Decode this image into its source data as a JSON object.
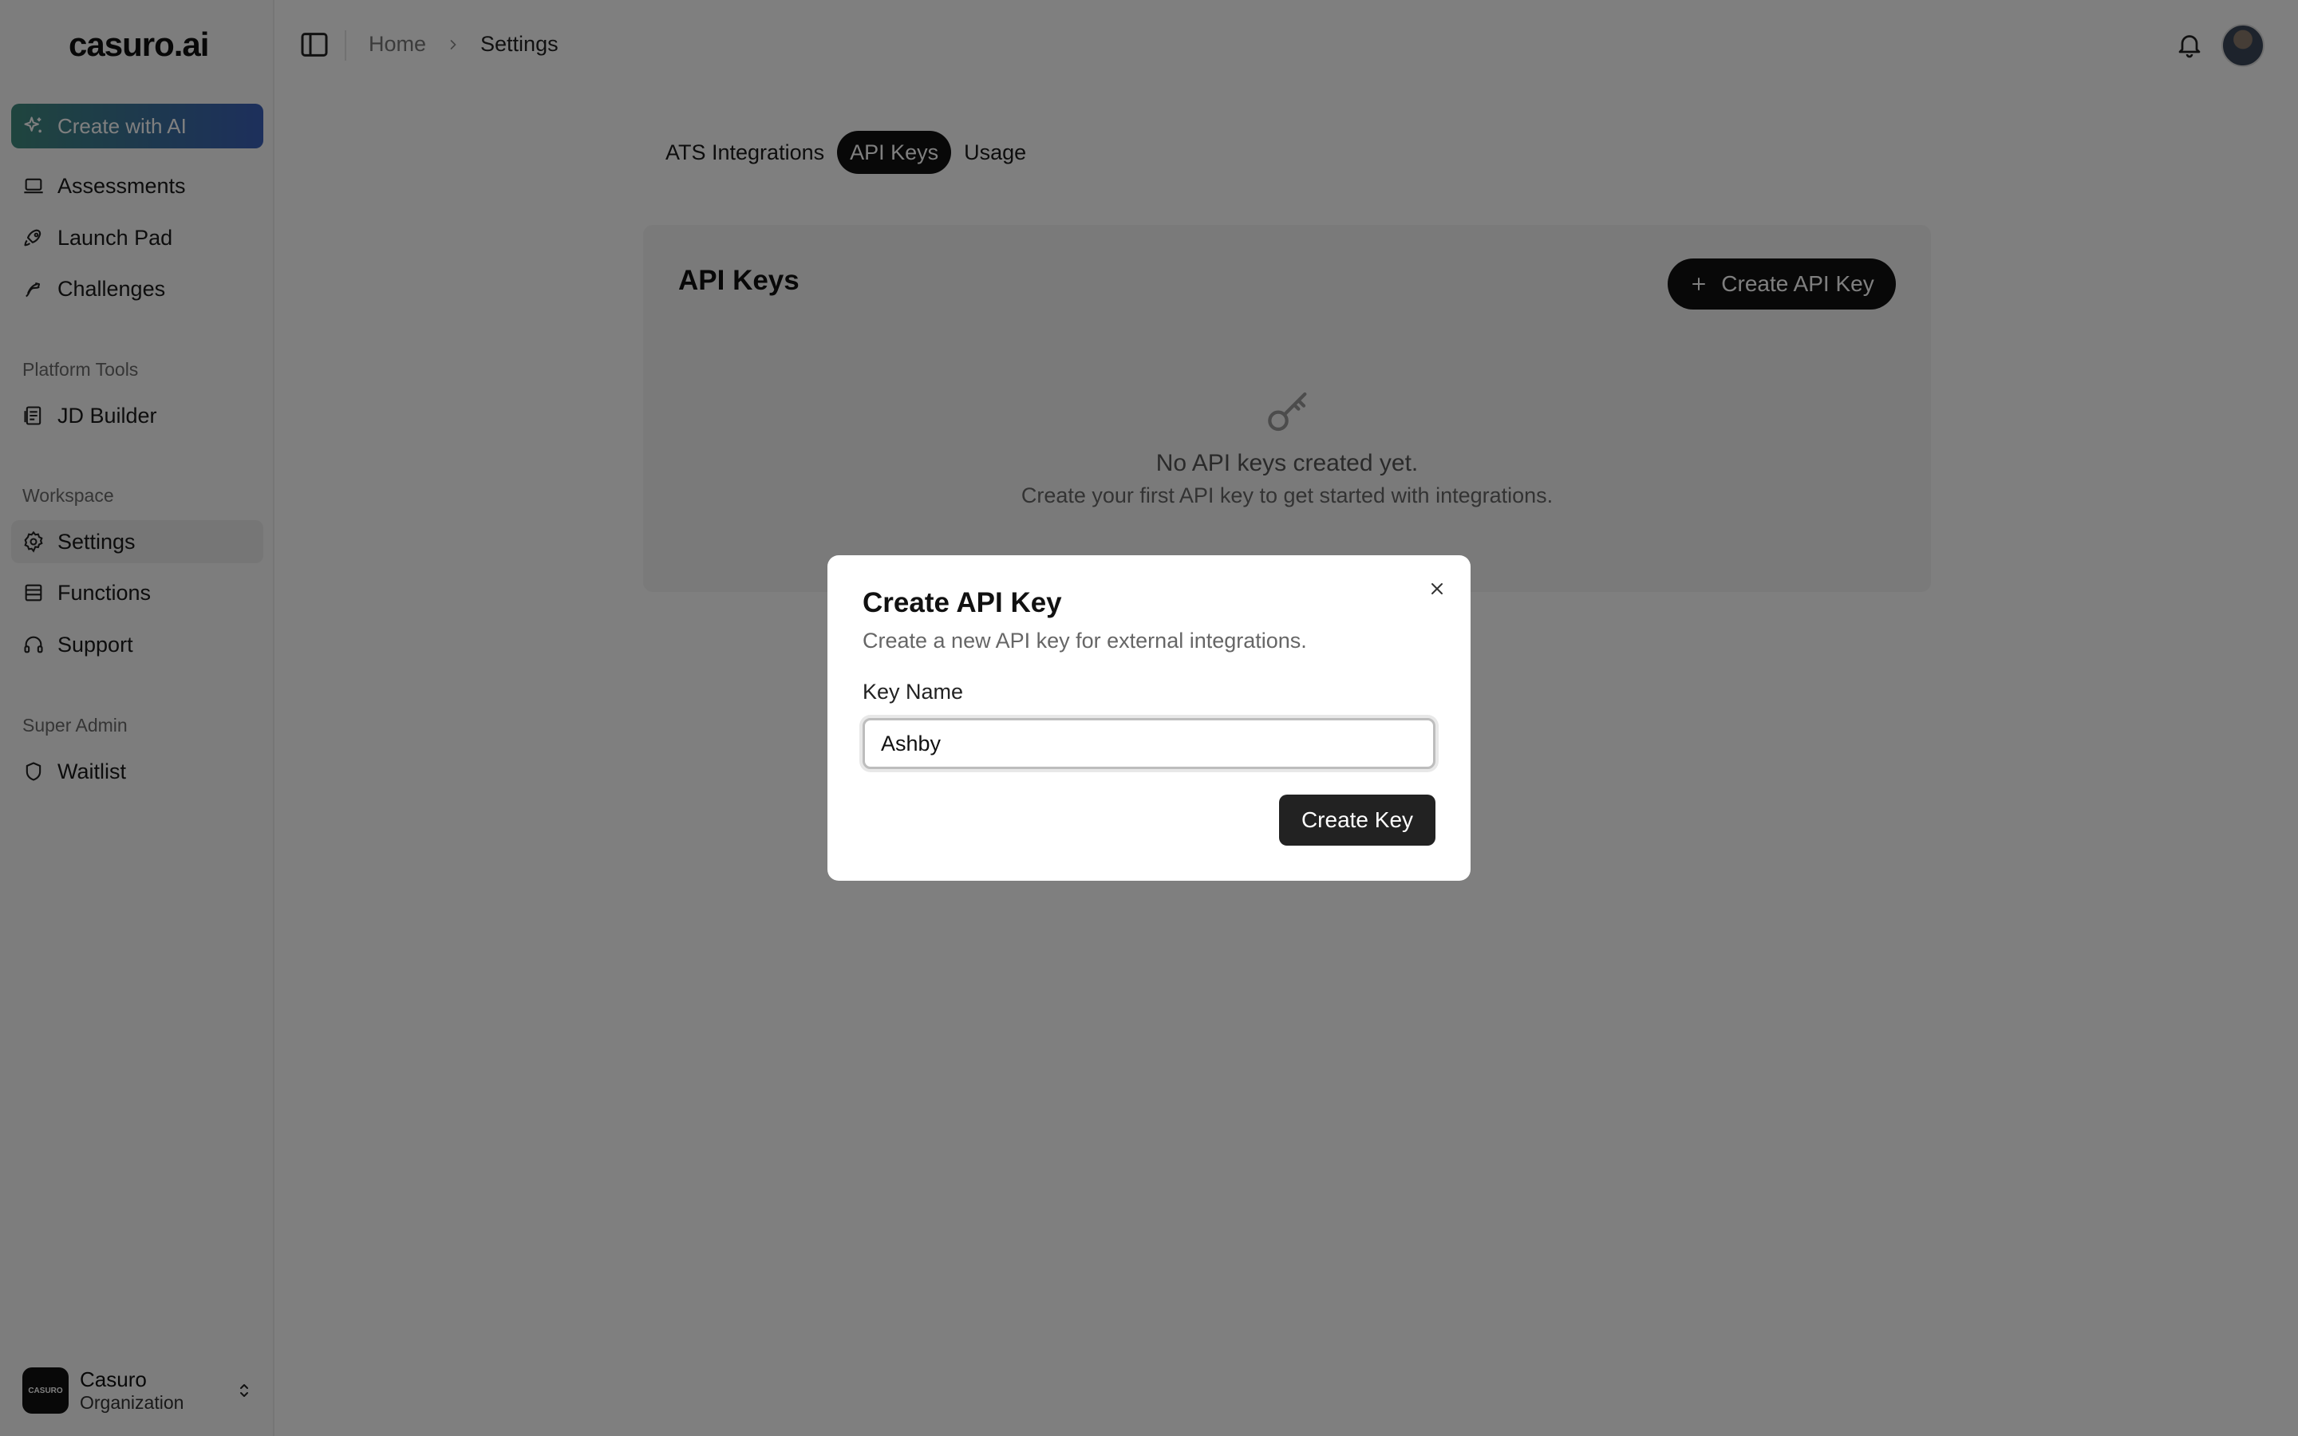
{
  "brand": {
    "logo_text": "casuro.ai"
  },
  "sidebar": {
    "create_ai_label": "Create with AI",
    "items_main": [
      {
        "label": "Assessments",
        "icon": "laptop-icon"
      },
      {
        "label": "Launch Pad",
        "icon": "rocket-icon"
      },
      {
        "label": "Challenges",
        "icon": "trophy-icon"
      }
    ],
    "section_platform": "Platform Tools",
    "items_platform": [
      {
        "label": "JD Builder",
        "icon": "document-builder-icon"
      }
    ],
    "section_workspace": "Workspace",
    "items_workspace": [
      {
        "label": "Settings",
        "icon": "gear-icon",
        "active": true
      },
      {
        "label": "Functions",
        "icon": "list-icon"
      },
      {
        "label": "Support",
        "icon": "headphones-icon"
      }
    ],
    "section_admin": "Super Admin",
    "items_admin": [
      {
        "label": "Waitlist",
        "icon": "shield-icon"
      }
    ],
    "org": {
      "logo_text": "CASURO",
      "name": "Casuro",
      "type": "Organization"
    }
  },
  "header": {
    "breadcrumb": {
      "home": "Home",
      "current": "Settings"
    }
  },
  "tabs": [
    {
      "label": "ATS Integrations",
      "active": false
    },
    {
      "label": "API Keys",
      "active": true
    },
    {
      "label": "Usage",
      "active": false
    }
  ],
  "api_keys_card": {
    "title": "API Keys",
    "create_button": "Create API Key",
    "empty_title": "No API keys created yet.",
    "empty_subtitle": "Create your first API key to get started with integrations."
  },
  "modal": {
    "title": "Create API Key",
    "description": "Create a new API key for external integrations.",
    "field_label": "Key Name",
    "field_value": "Ashby",
    "submit_label": "Create Key"
  },
  "colors": {
    "overlay": "rgba(0,0,0,0.5)",
    "primary": "#111111",
    "ai_gradient_start": "#3f8a7d",
    "ai_gradient_end": "#3a5fb8"
  }
}
